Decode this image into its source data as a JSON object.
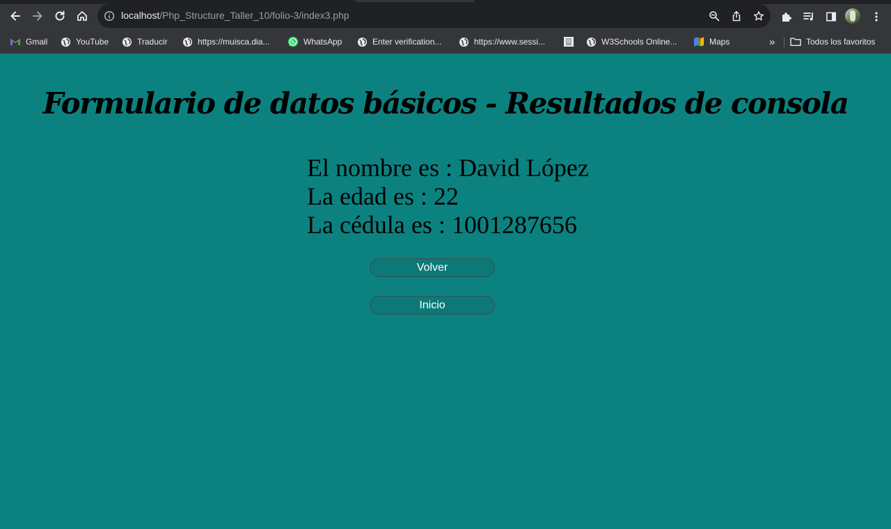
{
  "browser": {
    "url_host": "localhost",
    "url_path": "/Php_Structure_Taller_10/folio-3/index3.php",
    "bookmarks": [
      {
        "label": "Gmail",
        "icon": "gmail-icon"
      },
      {
        "label": "YouTube",
        "icon": "globe-icon"
      },
      {
        "label": "Traducir",
        "icon": "globe-icon"
      },
      {
        "label": "https://muisca.dia...",
        "icon": "globe-icon"
      },
      {
        "label": "WhatsApp",
        "icon": "whatsapp-icon"
      },
      {
        "label": "Enter verification...",
        "icon": "globe-icon"
      },
      {
        "label": "https://www.sessi...",
        "icon": "globe-icon"
      },
      {
        "label": "",
        "icon": "page-icon"
      },
      {
        "label": "W3Schools Online...",
        "icon": "globe-icon"
      },
      {
        "label": "Maps",
        "icon": "maps-icon"
      }
    ],
    "overflow_label": "»",
    "all_bookmarks_label": "Todos los favoritos"
  },
  "page": {
    "title": "Formulario de datos básicos - Resultados de consola",
    "results": [
      "El nombre es : David López",
      "La edad es : 22",
      "La cédula es : 1001287656"
    ],
    "buttons": {
      "back_label": "Volver",
      "home_label": "Inicio"
    }
  },
  "colors": {
    "page_background": "#0c8280",
    "chrome_background": "#35363a",
    "omnibox_background": "#202124"
  }
}
